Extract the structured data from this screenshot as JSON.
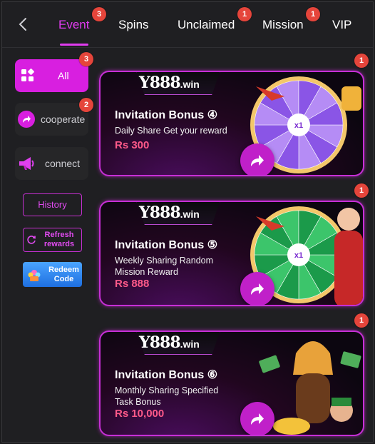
{
  "tabs": [
    {
      "label": "Event",
      "badge": "3",
      "active": true
    },
    {
      "label": "Spins",
      "badge": ""
    },
    {
      "label": "Unclaimed",
      "badge": "1"
    },
    {
      "label": "Mission",
      "badge": "1"
    },
    {
      "label": "VIP",
      "badge": ""
    }
  ],
  "sidebar": {
    "all": {
      "label": "All",
      "badge": "3"
    },
    "cooperate": {
      "label": "cooperate",
      "badge": "2"
    },
    "connect": {
      "label": "connect"
    },
    "history": "History",
    "refresh": "Refresh rewards",
    "redeem": "Redeem Code"
  },
  "cards": [
    {
      "logo": "Y888",
      "logo_suffix": ".win",
      "title": "Invitation Bonus ④",
      "subtitle": "Daily Share  Get your reward",
      "amount": "Rs 300",
      "badge": "1",
      "wheel": "purple"
    },
    {
      "logo": "Y888",
      "logo_suffix": ".win",
      "title": "Invitation Bonus ⑤",
      "subtitle": "Weekly Sharing Random Mission Reward",
      "amount": "Rs 888",
      "badge": "1",
      "wheel": "green"
    },
    {
      "logo": "Y888",
      "logo_suffix": ".win",
      "title": "Invitation Bonus ⑥",
      "subtitle": "Monthly Sharing Specified Task Bonus",
      "amount": "Rs 10,000",
      "badge": "1",
      "wheel": "none"
    }
  ],
  "colors": {
    "accent": "#d81fe0",
    "badge": "#e5453b",
    "amount": "#ff5a8a"
  }
}
